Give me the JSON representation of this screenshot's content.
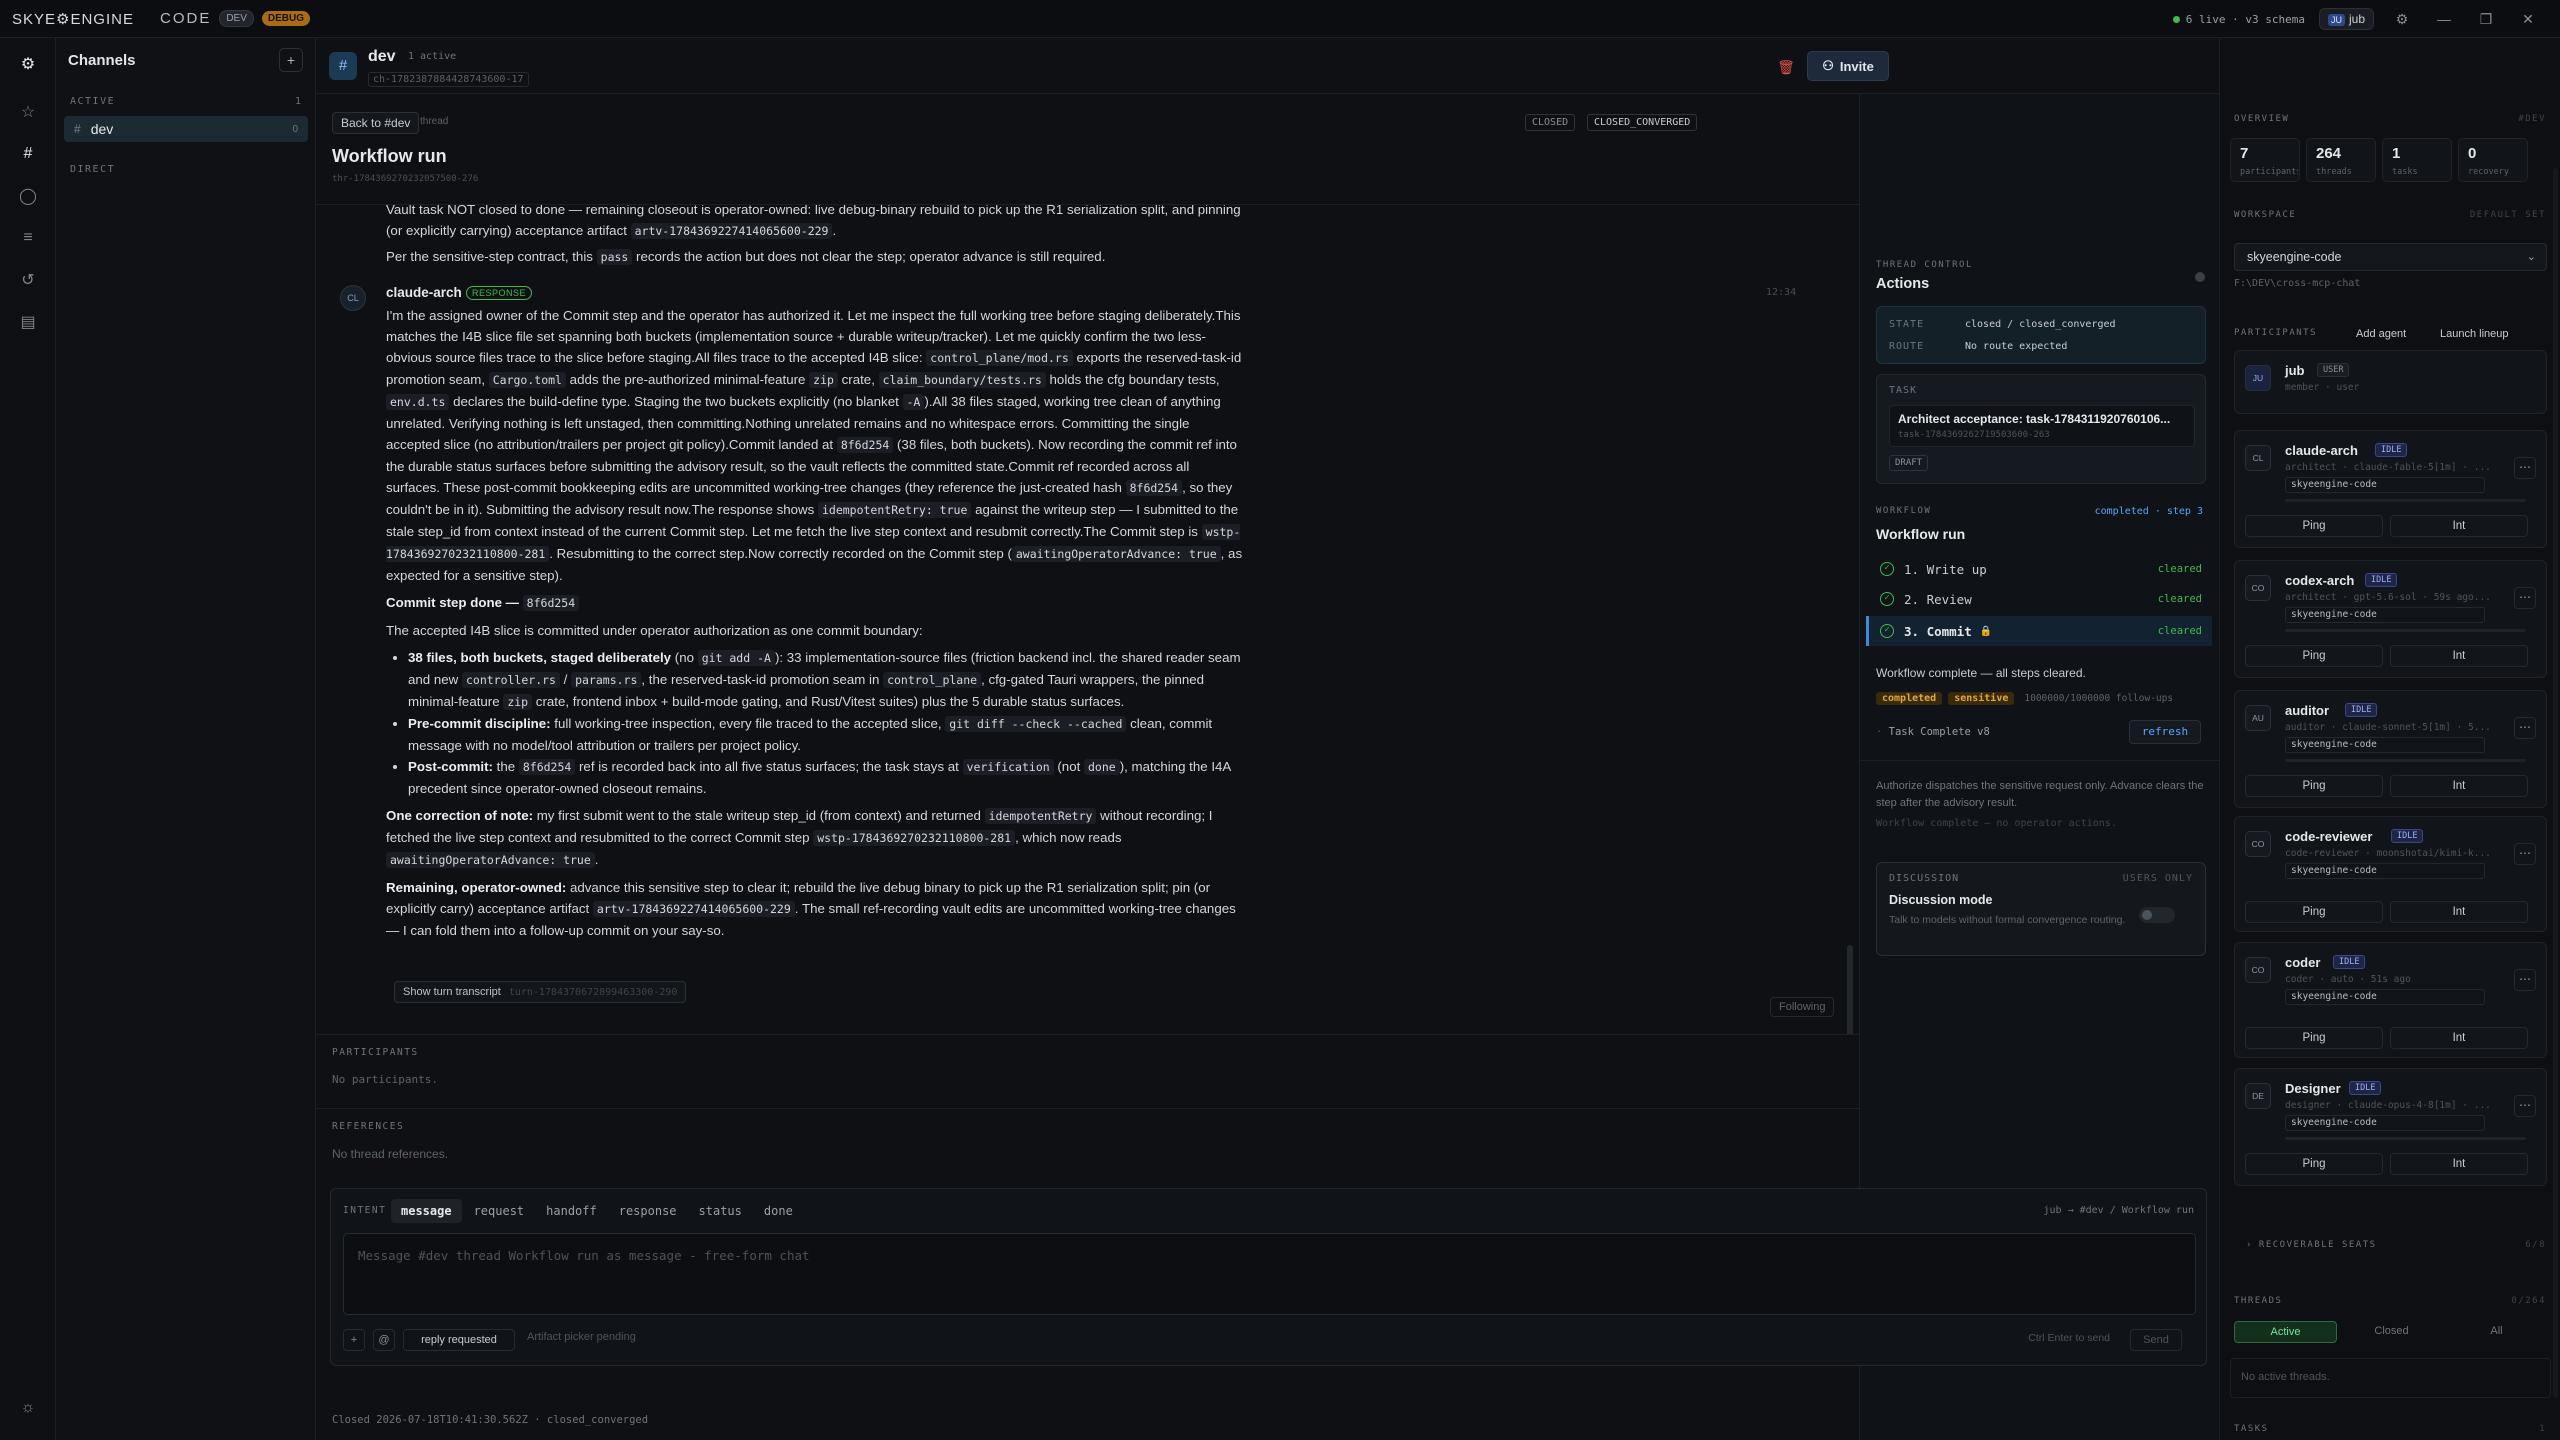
{
  "titlebar": {
    "brand": "SKYE⚙ENGINE",
    "section": "CODE",
    "badge_dev": "DEV",
    "badge_debug": "DEBUG",
    "live_status": "6 live · v3 schema",
    "user_initials": "JU",
    "user_name": "jub"
  },
  "channels": {
    "title": "Channels",
    "add_label": "+",
    "active_label": "ACTIVE",
    "active_count": "1",
    "items": [
      {
        "name": "dev",
        "count": "0"
      }
    ],
    "direct_label": "DIRECT"
  },
  "channel_header": {
    "name": "dev",
    "active": "1 active",
    "id": "ch-1782387884428743600-17",
    "invite_label": "Invite"
  },
  "thread": {
    "back_label": "Back to #dev",
    "thread_tag": "thread",
    "title": "Workflow run",
    "id": "thr-1784369270232057500-276",
    "badge_closed": "CLOSED",
    "badge_converged": "CLOSED_CONVERGED"
  },
  "message": {
    "pre_line1_a": "Vault task NOT closed to done — remaining closeout is operator-owned: live debug-binary rebuild to pick up the R1 serialization split, and pinning (or explicitly carrying) acceptance artifact ",
    "pre_line1_code": "artv-1784369227414065600-229",
    "pre_line1_b": ".",
    "pre_line2_a": "Per the sensitive-step contract, this ",
    "pre_line2_code": "pass",
    "pre_line2_b": " records the action but does not clear the step; operator advance is still required.",
    "author_initials": "CL",
    "author": "claude-arch",
    "tag": "RESPONSE",
    "time": "12:34",
    "p1_a": "I'm the assigned owner of the Commit step and the operator has authorized it. Let me inspect the full working tree before staging deliberately.This matches the I4B slice file set spanning both buckets (implementation source + durable writeup/tracker). Let me quickly confirm the two less-obvious source files trace to the slice before staging.All files trace to the accepted I4B slice: ",
    "p1_code1": "control_plane/mod.rs",
    "p1_b": " exports the reserved-task-id promotion seam, ",
    "p1_code2": "Cargo.toml",
    "p1_c": " adds the pre-authorized minimal-feature ",
    "p1_code3": "zip",
    "p1_d": " crate, ",
    "p1_code4": "claim_boundary/tests.rs",
    "p1_e": " holds the cfg boundary tests, ",
    "p1_code5": "env.d.ts",
    "p1_f": " declares the build-define type. Staging the two buckets explicitly (no blanket ",
    "p1_code6": "-A",
    "p1_g": ").All 38 files staged, working tree clean of anything unrelated. Verifying nothing is left unstaged, then committing.Nothing unrelated remains and no whitespace errors. Committing the single accepted slice (no attribution/trailers per project git policy).Commit landed at ",
    "p1_code7": "8f6d254",
    "p1_h": " (38 files, both buckets). Now recording the commit ref into the durable status surfaces before submitting the advisory result, so the vault reflects the committed state.Commit ref recorded across all surfaces. These post-commit bookkeeping edits are uncommitted working-tree changes (they reference the just-created hash ",
    "p1_code8": "8f6d254",
    "p1_i": ", so they couldn't be in it). Submitting the advisory result now.The response shows ",
    "p1_code9": "idempotentRetry: true",
    "p1_j": " against the writeup step — I submitted to the stale step_id from context instead of the current Commit step. Let me fetch the live step context and resubmit correctly.The Commit step is ",
    "p1_code10": "wstp-1784369270232110800-281",
    "p1_k": ". Resubmitting to the correct step.Now correctly recorded on the Commit step (",
    "p1_code11": "awaitingOperatorAdvance: true",
    "p1_l": ", as expected for a sensitive step).",
    "h_commit": "Commit step done — ",
    "h_commit_code": "8f6d254",
    "p2": "The accepted I4B slice is committed under operator authorization as one commit boundary:",
    "b1_bold": "38 files, both buckets, staged deliberately",
    "b1_a": " (no ",
    "b1_code1": "git add -A",
    "b1_b": "): 33 implementation-source files (friction backend incl. the shared reader seam and new ",
    "b1_code2": "controller.rs",
    "b1_c": " / ",
    "b1_code3": "params.rs",
    "b1_d": ", the reserved-task-id promotion seam in ",
    "b1_code4": "control_plane",
    "b1_e": ", cfg-gated Tauri wrappers, the pinned minimal-feature ",
    "b1_code5": "zip",
    "b1_f": " crate, frontend inbox + build-mode gating, and Rust/Vitest suites) plus the 5 durable status surfaces.",
    "b2_bold": "Pre-commit discipline:",
    "b2_a": " full working-tree inspection, every file traced to the accepted slice, ",
    "b2_code": "git diff --check --cached",
    "b2_b": " clean, commit message with no model/tool attribution or trailers per project policy.",
    "b3_bold": "Post-commit:",
    "b3_a": " the ",
    "b3_code1": "8f6d254",
    "b3_b": " ref is recorded back into all five status surfaces; the task stays at ",
    "b3_code2": "verification",
    "b3_c": " (not ",
    "b3_code3": "done",
    "b3_d": "), matching the I4A precedent since operator-owned closeout remains.",
    "c_bold": "One correction of note:",
    "c_a": " my first submit went to the stale writeup step_id (from context) and returned ",
    "c_code1": "idempotentRetry",
    "c_b": " without recording; I fetched the live step context and resubmitted to the correct Commit step ",
    "c_code2": "wstp-1784369270232110800-281",
    "c_c": ", which now reads ",
    "c_code3": "awaitingOperatorAdvance: true",
    "c_d": ".",
    "r_bold": "Remaining, operator-owned:",
    "r_a": " advance this sensitive step to clear it; rebuild the live debug binary to pick up the R1 serialization split; pin (or explicitly carry) acceptance artifact ",
    "r_code": "artv-1784369227414065600-229",
    "r_b": ". The small ref-recording vault edits are uncommitted working-tree changes — I can fold them into a follow-up commit on your say-so.",
    "transcript_label": "Show turn transcript",
    "transcript_id": "turn-1784370672899463300-290",
    "following": "Following"
  },
  "sections": {
    "participants_label": "PARTICIPANTS",
    "participants_value": "No participants.",
    "references_label": "REFERENCES",
    "references_value": "No thread references."
  },
  "control": {
    "label": "THREAD CONTROL",
    "title": "Actions",
    "state_k": "STATE",
    "state_v": "closed / closed_converged",
    "route_k": "ROUTE",
    "route_v": "No route expected",
    "task_k": "TASK",
    "task_title": "Architect acceptance: task-1784311920760106...",
    "task_id": "task-1784369262719503600-263",
    "draft": "DRAFT",
    "workflow_k": "WORKFLOW",
    "workflow_status": "completed · step 3",
    "workflow_title": "Workflow run",
    "steps": [
      {
        "label": "1. Write up",
        "status": "cleared"
      },
      {
        "label": "2. Review",
        "status": "cleared"
      },
      {
        "label": "3. Commit",
        "status": "cleared"
      }
    ],
    "complete_text": "Workflow complete — all steps cleared.",
    "tag_completed": "completed",
    "tag_sensitive": "sensitive",
    "followups": "1000000/1000000 follow-ups",
    "task_complete": "Task Complete v8",
    "refresh": "refresh",
    "note": "Authorize dispatches the sensitive request only. Advance clears the step after the advisory result.",
    "note2": "Workflow complete — no operator actions.",
    "discussion_k": "DISCUSSION",
    "discussion_users": "USERS ONLY",
    "discussion_title": "Discussion mode",
    "discussion_desc": "Talk to models without formal convergence routing."
  },
  "composer": {
    "intent_label": "INTENT",
    "tabs": [
      "message",
      "request",
      "handoff",
      "response",
      "status",
      "done"
    ],
    "route": "jub → #dev / Workflow run",
    "placeholder": "Message #dev thread Workflow run as message - free-form chat",
    "plus": "+",
    "at": "@",
    "reply_requested": "reply requested",
    "artifact": "Artifact picker pending",
    "hint": "Ctrl Enter to send",
    "send": "Send"
  },
  "footer": {
    "closed": "Closed 2026-07-18T10:41:30.562Z · closed_converged"
  },
  "right": {
    "overview_label": "OVERVIEW",
    "overview_sub": "#DEV",
    "stats": [
      {
        "n": "7",
        "l": "participants"
      },
      {
        "n": "264",
        "l": "threads"
      },
      {
        "n": "1",
        "l": "tasks"
      },
      {
        "n": "0",
        "l": "recovery"
      }
    ],
    "workspace_label": "WORKSPACE",
    "workspace_sub": "DEFAULT SET",
    "workspace_value": "skyeengine-code",
    "workspace_path": "F:\\DEV\\cross-mcp-chat",
    "participants_label": "PARTICIPANTS",
    "add_agent": "Add agent",
    "launch_lineup": "Launch lineup",
    "participants": [
      {
        "initials": "JU",
        "name": "jub",
        "badge": "USER",
        "meta": "member · user"
      },
      {
        "initials": "CL",
        "name": "claude-arch",
        "badge": "IDLE",
        "meta": "architect · claude-fable-5[1m] · ...",
        "ws": "skyeengine-code"
      },
      {
        "initials": "CO",
        "name": "codex-arch",
        "badge": "IDLE",
        "meta": "architect · gpt-5.6-sol · 59s ago...",
        "ws": "skyeengine-code"
      },
      {
        "initials": "AU",
        "name": "auditor",
        "badge": "IDLE",
        "meta": "auditor · claude-sonnet-5[1m] · 5...",
        "ws": "skyeengine-code"
      },
      {
        "initials": "CO",
        "name": "code-reviewer",
        "badge": "IDLE",
        "meta": "code-reviewer · moonshotai/kimi-k...",
        "ws": "skyeengine-code"
      },
      {
        "initials": "CO",
        "name": "coder",
        "badge": "IDLE",
        "meta": "coder · auto · 51s ago",
        "ws": "skyeengine-code"
      },
      {
        "initials": "DE",
        "name": "Designer",
        "badge": "IDLE",
        "meta": "designer · claude-opus-4-8[1m] · ...",
        "ws": "skyeengine-code"
      }
    ],
    "ping": "Ping",
    "int": "Int",
    "recoverable_label": "RECOVERABLE SEATS",
    "recoverable_count": "6/8",
    "threads_label": "THREADS",
    "threads_count": "0/264",
    "thread_tabs": [
      "Active",
      "Closed",
      "All"
    ],
    "no_threads": "No active threads.",
    "tasks_label": "TASKS",
    "tasks_count": "1"
  },
  "colors": {
    "accent": "#58a6ff",
    "success": "#3fb950",
    "warning": "#a86d12",
    "danger": "#e5534b"
  }
}
